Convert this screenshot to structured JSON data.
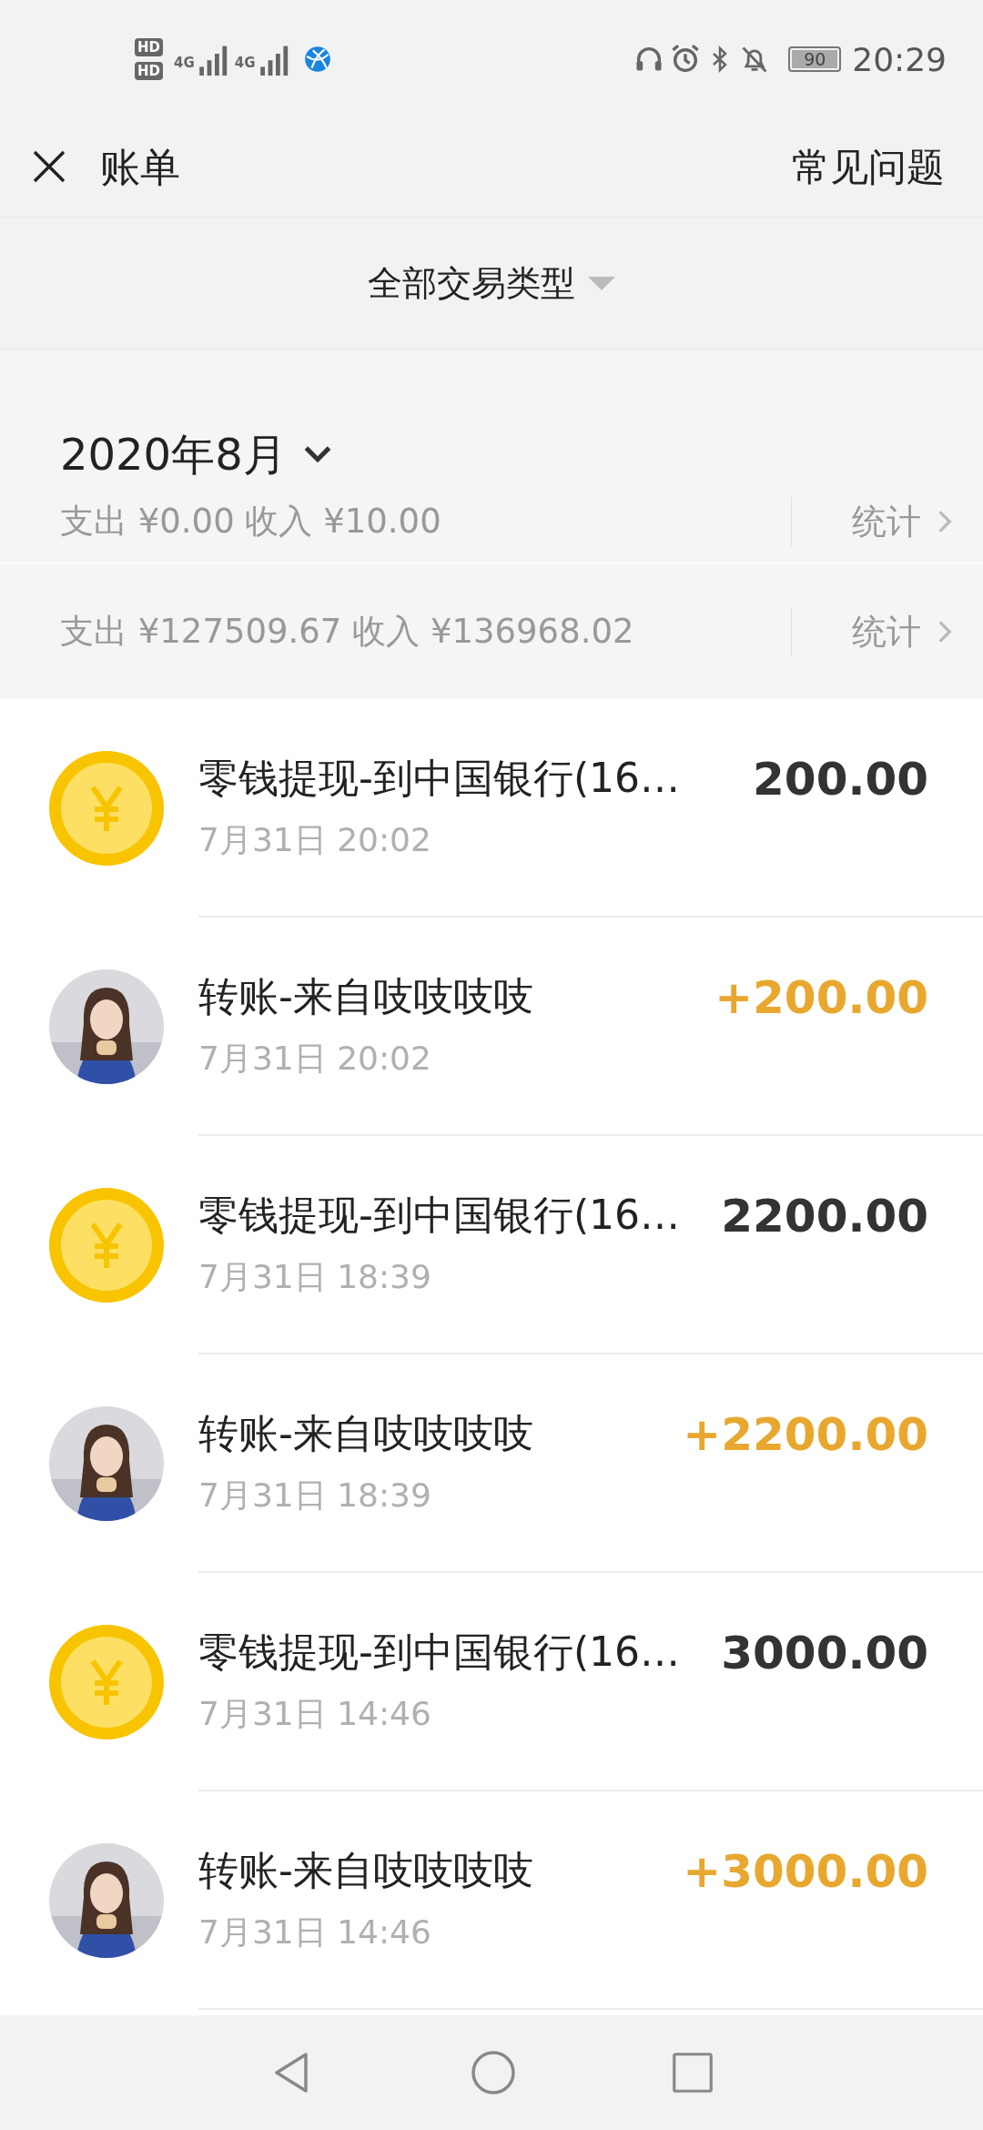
{
  "status_bar": {
    "time": "20:29",
    "battery": "90",
    "sim_labels": [
      "HD",
      "HD"
    ],
    "network_labels": [
      "4G",
      "4G"
    ]
  },
  "header": {
    "title": "账单",
    "help_link": "常见问题"
  },
  "filter": {
    "label": "全部交易类型"
  },
  "months": [
    {
      "title": "2020年8月",
      "summary": "支出 ¥0.00 收入 ¥10.00",
      "stats_link": "统计"
    },
    {
      "summary": "支出 ¥127509.67 收入 ¥136968.02",
      "stats_link": "统计"
    }
  ],
  "transactions": [
    {
      "kind": "withdrawal",
      "title": "零钱提现-到中国银行(16…",
      "time": "7月31日 20:02",
      "amount": "200.00"
    },
    {
      "kind": "transfer",
      "title": "转账-来自吱吱吱吱",
      "time": "7月31日 20:02",
      "amount": "+200.00"
    },
    {
      "kind": "withdrawal",
      "title": "零钱提现-到中国银行(16…",
      "time": "7月31日 18:39",
      "amount": "2200.00"
    },
    {
      "kind": "transfer",
      "title": "转账-来自吱吱吱吱",
      "time": "7月31日 18:39",
      "amount": "+2200.00"
    },
    {
      "kind": "withdrawal",
      "title": "零钱提现-到中国银行(16…",
      "time": "7月31日 14:46",
      "amount": "3000.00"
    },
    {
      "kind": "transfer",
      "title": "转账-来自吱吱吱吱",
      "time": "7月31日 14:46",
      "amount": "+3000.00"
    }
  ]
}
